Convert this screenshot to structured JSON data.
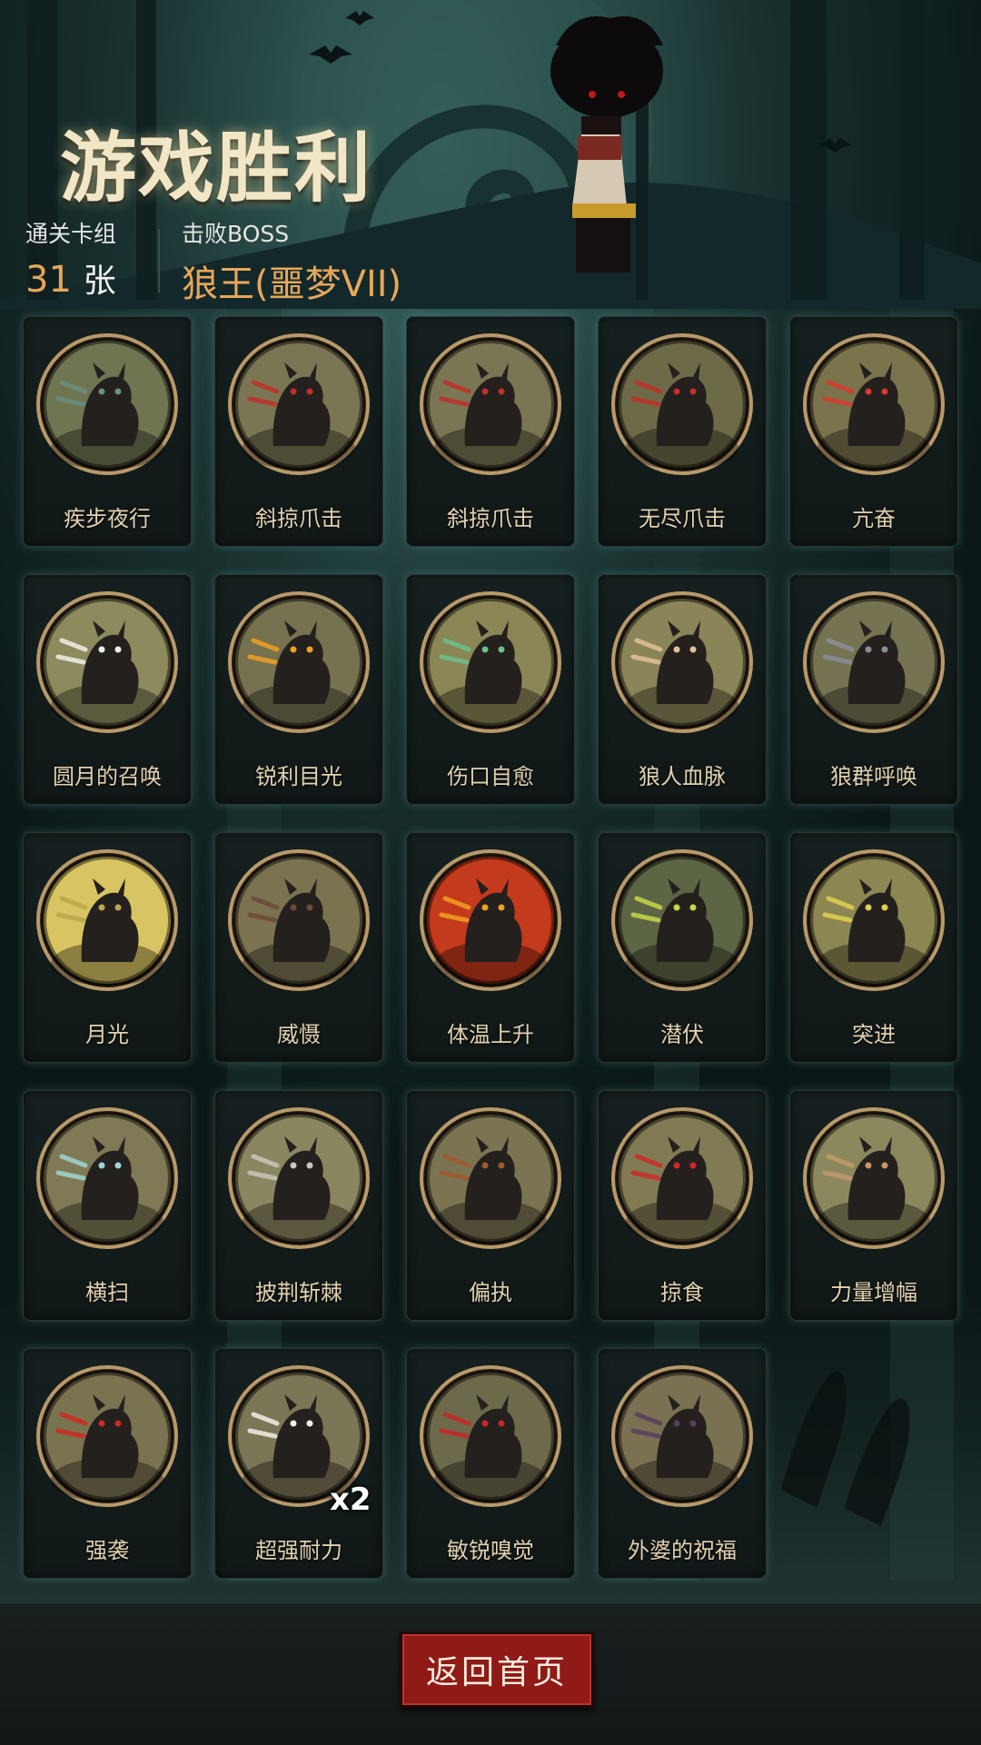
{
  "result": {
    "title": "游戏胜利",
    "deck_label": "通关卡组",
    "deck_count": "31",
    "deck_unit": "张",
    "boss_label": "击败BOSS",
    "boss_name": "狼王(噩梦VII)"
  },
  "cards": [
    {
      "name": "疾步夜行",
      "icon": "running-werewolf",
      "bg": "#6f7550",
      "accent": "#6a8f83"
    },
    {
      "name": "斜掠爪击",
      "icon": "clawing-werewolf",
      "bg": "#7a7654",
      "accent": "#c0302a"
    },
    {
      "name": "斜掠爪击",
      "icon": "clawing-werewolf",
      "bg": "#7a7654",
      "accent": "#c0302a"
    },
    {
      "name": "无尽爪击",
      "icon": "claw-slash",
      "bg": "#6d6a47",
      "accent": "#c0302a"
    },
    {
      "name": "亢奋",
      "icon": "enraged-werewolf",
      "bg": "#7a744d",
      "accent": "#d63a30"
    },
    {
      "name": "圆月的召唤",
      "icon": "full-moon-forest",
      "bg": "#8d8a5d",
      "accent": "#f0f0ea"
    },
    {
      "name": "锐利目光",
      "icon": "glaring-werewolf",
      "bg": "#767250",
      "accent": "#f0a020"
    },
    {
      "name": "伤口自愈",
      "icon": "healing-boy",
      "bg": "#8a8656",
      "accent": "#6fbf8a"
    },
    {
      "name": "狼人血脉",
      "icon": "bloodline-arm",
      "bg": "#8a8558",
      "accent": "#e4c09a"
    },
    {
      "name": "狼群呼唤",
      "icon": "wolf-pack",
      "bg": "#767352",
      "accent": "#8b8f9a"
    },
    {
      "name": "月光",
      "icon": "moonlight",
      "bg": "#d8c463",
      "accent": "#b9a84c"
    },
    {
      "name": "威慑",
      "icon": "bear-intimidate",
      "bg": "#7b7350",
      "accent": "#6b4a38"
    },
    {
      "name": "体温上升",
      "icon": "burning-werewolf",
      "bg": "#c43a1c",
      "accent": "#f4a020"
    },
    {
      "name": "潜伏",
      "icon": "lurking-werewolf",
      "bg": "#5d6644",
      "accent": "#c8d64a"
    },
    {
      "name": "突进",
      "icon": "dash-werewolf",
      "bg": "#8c8652",
      "accent": "#e0d050"
    },
    {
      "name": "横扫",
      "icon": "sweep-werewolf",
      "bg": "#7f7a55",
      "accent": "#9fd6d6"
    },
    {
      "name": "披荆斩棘",
      "icon": "axe-thorns",
      "bg": "#8a8660",
      "accent": "#c8c8be"
    },
    {
      "name": "偏执",
      "icon": "wolf-and-bear",
      "bg": "#7a7452",
      "accent": "#a0592e"
    },
    {
      "name": "掠食",
      "icon": "predator-wolf",
      "bg": "#807b54",
      "accent": "#d02828"
    },
    {
      "name": "力量增幅",
      "icon": "log-lifter",
      "bg": "#8b885e",
      "accent": "#c49a6c"
    },
    {
      "name": "强袭",
      "icon": "howling-werewolf",
      "bg": "#7a7350",
      "accent": "#cf2a20"
    },
    {
      "name": "超强耐力",
      "icon": "woodchopper-boy",
      "bg": "#7b7656",
      "accent": "#f0f0e6",
      "count": "x2"
    },
    {
      "name": "敏锐嗅觉",
      "icon": "sniffing-wolf",
      "bg": "#6d6a4c",
      "accent": "#c62828"
    },
    {
      "name": "外婆的祝福",
      "icon": "grandma-reading",
      "bg": "#7a7152",
      "accent": "#5a3f5c"
    }
  ],
  "footer": {
    "home_button": "返回首页"
  },
  "colors": {
    "accent_gold": "#e7a75a",
    "button_red": "#8f1a16",
    "card_name": "#e2d2b0"
  }
}
